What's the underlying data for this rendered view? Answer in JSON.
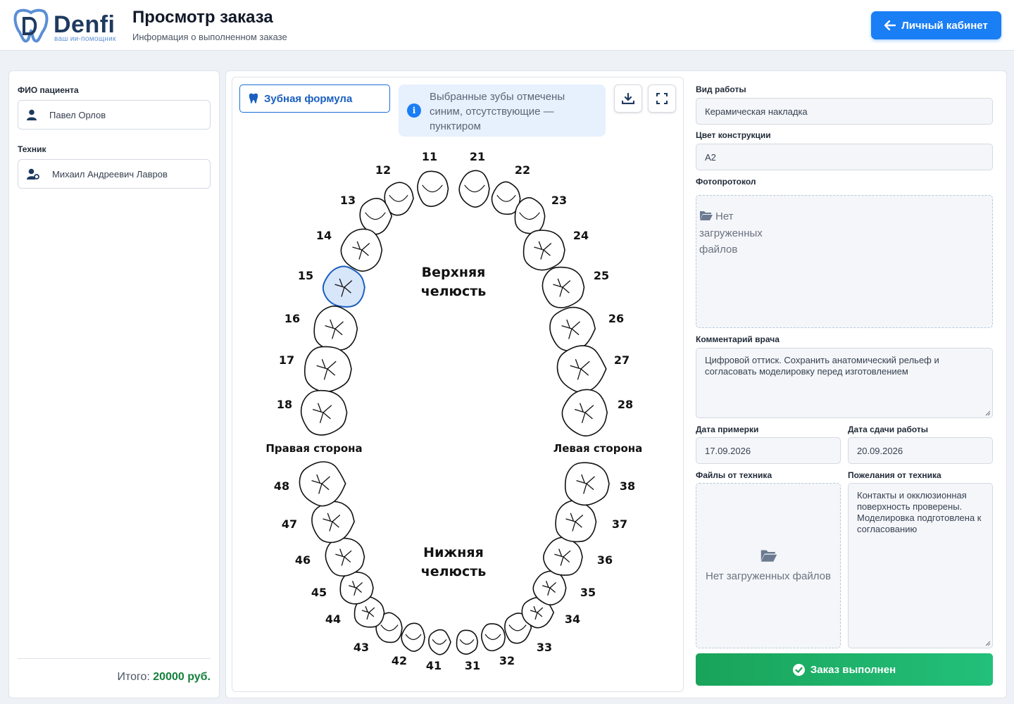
{
  "brand": {
    "name": "Denfi",
    "tagline": "ваш ии-помощник"
  },
  "header": {
    "title": "Просмотр заказа",
    "subtitle": "Информация о выполненном заказе",
    "cabinet_button": "Личный кабинет"
  },
  "left": {
    "patient_label": "ФИО пациента",
    "patient_name": "Павел Орлов",
    "technician_label": "Техник",
    "technician_name": "Михаил Андреевич Лавров",
    "total_label": "Итого:",
    "total_value": "20000 руб."
  },
  "center": {
    "formula_button": "Зубная формула",
    "info_text": "Выбранные зубы отмечены синим, отсутствующие — пунктиром",
    "upper_jaw_line1": "Верхняя",
    "upper_jaw_line2": "челюсть",
    "lower_jaw_line1": "Нижняя",
    "lower_jaw_line2": "челюсть",
    "right_side": "Правая сторона",
    "left_side": "Левая сторона",
    "selected_teeth": [
      "15"
    ],
    "selected_color": "#d8e6fa",
    "upper_teeth": [
      "11",
      "12",
      "13",
      "14",
      "15",
      "16",
      "17",
      "18",
      "21",
      "22",
      "23",
      "24",
      "25",
      "26",
      "27",
      "28"
    ],
    "lower_teeth": [
      "31",
      "32",
      "33",
      "34",
      "35",
      "36",
      "37",
      "38",
      "41",
      "42",
      "43",
      "44",
      "45",
      "46",
      "47",
      "48"
    ]
  },
  "right": {
    "work_type_label": "Вид работы",
    "work_type": "Керамическая накладка",
    "color_label": "Цвет конструкции",
    "color_value": "A2",
    "photo_label": "Фотопротокол",
    "photo_empty": "Нет загруженных файлов",
    "comment_label": "Комментарий врача",
    "comment": "Цифровой оттиск. Сохранить анатомический рельеф и согласовать моделировку перед изготовлением",
    "fitting_label": "Дата примерки",
    "fitting_date": "17.09.2026",
    "delivery_label": "Дата сдачи работы",
    "delivery_date": "20.09.2026",
    "tech_files_label": "Файлы от техника",
    "tech_files_empty": "Нет загруженных файлов",
    "tech_wishes_label": "Пожелания от техника",
    "tech_wishes": "Контакты и окклюзионная поверхность проверены. Моделировка подготовлена к согласованию",
    "done_button": "Заказ выполнен"
  },
  "colors": {
    "accent": "#1a7ef5",
    "success": "#1aa35a",
    "total": "#15803d"
  }
}
